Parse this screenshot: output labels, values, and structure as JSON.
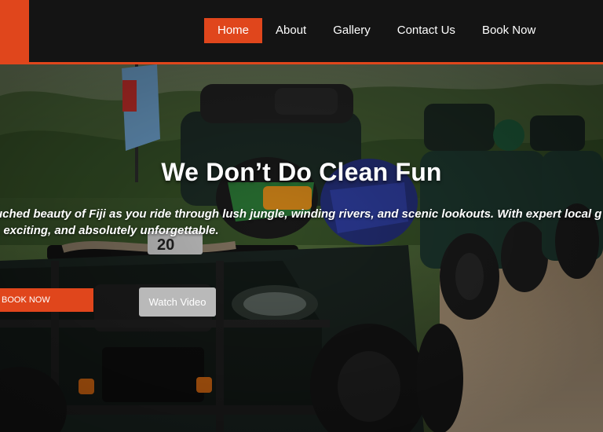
{
  "nav": {
    "items": [
      {
        "label": "Home",
        "active": true
      },
      {
        "label": "About"
      },
      {
        "label": "Gallery"
      },
      {
        "label": "Contact Us"
      },
      {
        "label": "Book Now"
      }
    ]
  },
  "hero": {
    "title": "We Don’t Do Clean Fun",
    "line1": "uched beauty of Fiji as you ride through lush jungle, winding rivers, and scenic lookouts. With expert local g",
    "line2": ", exciting, and absolutely unforgettable.",
    "book_button": "BOOK NOW",
    "watch_button": "Watch Video",
    "plate_text": "20"
  },
  "colors": {
    "accent": "#e0461c",
    "header_bg": "#141414",
    "watch_button_bg": "#b9b9b9"
  }
}
